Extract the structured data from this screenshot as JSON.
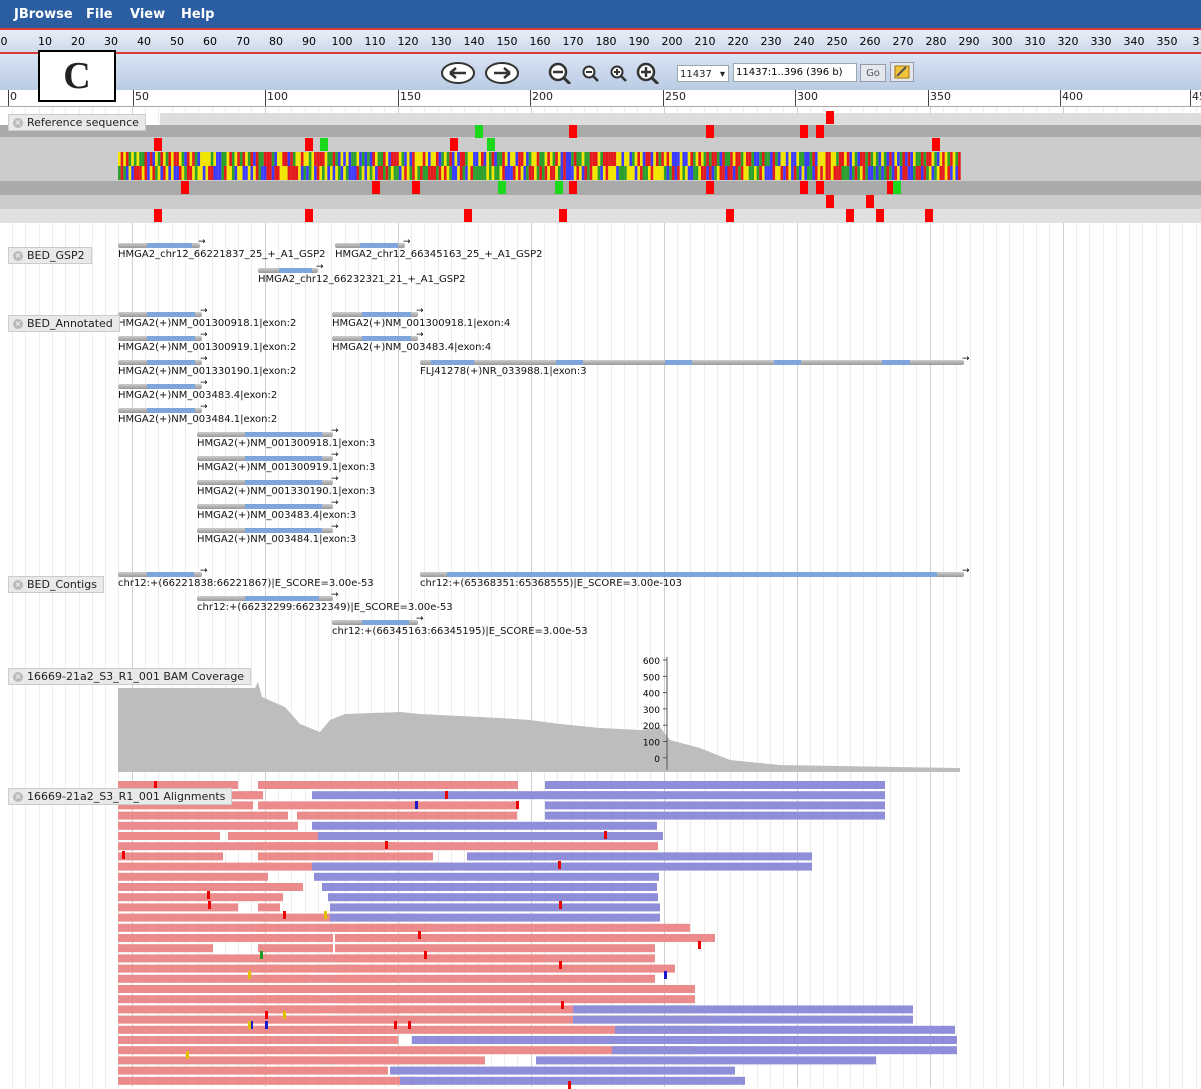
{
  "menubar": {
    "brand": "JBrowse",
    "items": [
      "File",
      "View",
      "Help"
    ]
  },
  "overview": {
    "ticks": [
      "0",
      "10",
      "20",
      "30",
      "40",
      "50",
      "60",
      "70",
      "80",
      "90",
      "100",
      "110",
      "120",
      "130",
      "140",
      "150",
      "160",
      "170",
      "180",
      "190",
      "200",
      "210",
      "220",
      "230",
      "240",
      "250",
      "260",
      "270",
      "280",
      "290",
      "300",
      "310",
      "320",
      "330",
      "340",
      "350",
      "3"
    ]
  },
  "panel_letter": "C",
  "nav": {
    "ref_seq": "11437",
    "location": "11437:1..396 (396 b)",
    "go_label": "Go",
    "icons": [
      "pan-left-icon",
      "pan-right-icon",
      "zoom-out-large-icon",
      "zoom-out-icon",
      "zoom-in-icon",
      "zoom-in-large-icon"
    ]
  },
  "ruler": {
    "ticks": [
      "0",
      "50",
      "100",
      "150",
      "200",
      "250",
      "300",
      "350",
      "400",
      "45"
    ]
  },
  "tracks": {
    "reference": {
      "label": "Reference sequence"
    },
    "bed_gsp2": {
      "label": "BED_GSP2",
      "features": [
        "HMGA2_chr12_66221837_25_+_A1_GSP2",
        "HMGA2_chr12_66345163_25_+_A1_GSP2",
        "HMGA2_chr12_66232321_21_+_A1_GSP2"
      ]
    },
    "bed_annotated": {
      "label": "BED_Annotated",
      "features": [
        "HMGA2(+)NM_001300918.1|exon:2",
        "HMGA2(+)NM_001300918.1|exon:4",
        "HMGA2(+)NM_001300919.1|exon:2",
        "HMGA2(+)NM_003483.4|exon:4",
        "HMGA2(+)NM_001330190.1|exon:2",
        "FLJ41278(+)NR_033988.1|exon:3",
        "HMGA2(+)NM_003483.4|exon:2",
        "HMGA2(+)NM_003484.1|exon:2",
        "HMGA2(+)NM_001300918.1|exon:3",
        "HMGA2(+)NM_001300919.1|exon:3",
        "HMGA2(+)NM_001330190.1|exon:3",
        "HMGA2(+)NM_003483.4|exon:3",
        "HMGA2(+)NM_003484.1|exon:3"
      ]
    },
    "bed_contigs": {
      "label": "BED_Contigs",
      "features": [
        "chr12:+(66221838:66221867)|E_SCORE=3.00e-53",
        "chr12:+(65368351:65368555)|E_SCORE=3.00e-103",
        "chr12:+(66232299:66232349)|E_SCORE=3.00e-53",
        "chr12:+(66345163:66345195)|E_SCORE=3.00e-53"
      ]
    },
    "coverage": {
      "label": "16669-21a2_S3_R1_001 BAM Coverage",
      "axis": [
        "600",
        "500",
        "400",
        "300",
        "200",
        "100",
        "0"
      ]
    },
    "alignments": {
      "label": "16669-21a2_S3_R1_001 Alignments"
    }
  },
  "colors": {
    "menubar": "#2a5ea0",
    "forward_read": "#ec8b8b",
    "reverse_read": "#8f8fd9",
    "coverage": "#bdbdbd",
    "feature_blue": "#7fa6dc"
  }
}
